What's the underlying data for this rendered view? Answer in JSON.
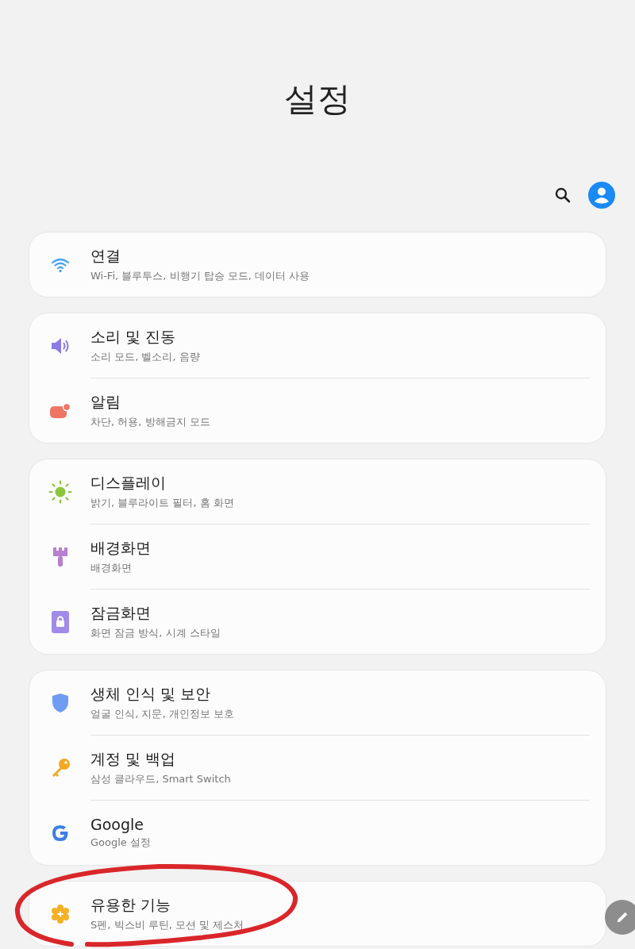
{
  "header": {
    "title": "설정"
  },
  "groups": [
    {
      "items": [
        {
          "kind": "wifi",
          "title": "연결",
          "subtitle": "Wi-Fi, 블루투스, 비행기 탑승 모드, 데이터 사용"
        }
      ]
    },
    {
      "items": [
        {
          "kind": "sound",
          "title": "소리 및 진동",
          "subtitle": "소리 모드, 벨소리, 음량"
        },
        {
          "kind": "notification",
          "title": "알림",
          "subtitle": "차단, 허용, 방해금지 모드"
        }
      ]
    },
    {
      "items": [
        {
          "kind": "display",
          "title": "디스플레이",
          "subtitle": "밝기, 블루라이트 필터, 홈 화면"
        },
        {
          "kind": "wallpaper",
          "title": "배경화면",
          "subtitle": "배경화면"
        },
        {
          "kind": "lock",
          "title": "잠금화면",
          "subtitle": "화면 잠금 방식, 시계 스타일"
        }
      ]
    },
    {
      "items": [
        {
          "kind": "security",
          "title": "생체 인식 및 보안",
          "subtitle": "얼굴 인식, 지문, 개인정보 보호"
        },
        {
          "kind": "account",
          "title": "계정 및 백업",
          "subtitle": "삼성 클라우드, Smart Switch"
        },
        {
          "kind": "google",
          "title": "Google",
          "subtitle": "Google 설정"
        }
      ]
    },
    {
      "items": [
        {
          "kind": "features",
          "title": "유용한 기능",
          "subtitle": "S펜, 빅스비 루틴, 모션 및 제스처"
        }
      ]
    }
  ]
}
